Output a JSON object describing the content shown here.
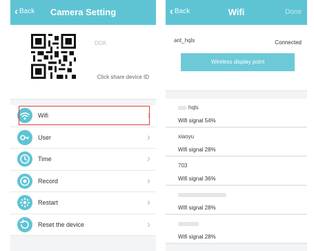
{
  "left_screen": {
    "nav": {
      "back_label": "Back",
      "title": "Camera Setting"
    },
    "device_id": "DGK",
    "share_hint": "Click share device ID",
    "menu": [
      {
        "label": "Wifi",
        "icon": "wifi-icon",
        "selected": true
      },
      {
        "label": "User",
        "icon": "user-key-icon",
        "selected": false
      },
      {
        "label": "Time",
        "icon": "clock-icon",
        "selected": false
      },
      {
        "label": "Record",
        "icon": "record-icon",
        "selected": false
      },
      {
        "label": "Restart",
        "icon": "restart-icon",
        "selected": false
      },
      {
        "label": "Reset the device",
        "icon": "reset-icon",
        "selected": false
      }
    ]
  },
  "right_screen": {
    "nav": {
      "back_label": "Back",
      "title": "Wifi",
      "right_label": "Done"
    },
    "connected_ssid": "ant_hqls",
    "connected_status": "Connected",
    "wireless_button": "Wireless display point",
    "networks": [
      {
        "ssid": "hqls",
        "signal": "Wifi signal  54%"
      },
      {
        "ssid": "xiaoyu",
        "signal": "Wifi signal  28%"
      },
      {
        "ssid": "703",
        "signal": "Wifi signal  36%"
      },
      {
        "ssid": "",
        "signal": "Wifi signal  28%"
      },
      {
        "ssid": "",
        "signal": "Wifi signal  28%"
      }
    ]
  },
  "colors": {
    "accent": "#5ec4d4",
    "highlight": "#e03a3a",
    "background": "#f2f4f5"
  }
}
